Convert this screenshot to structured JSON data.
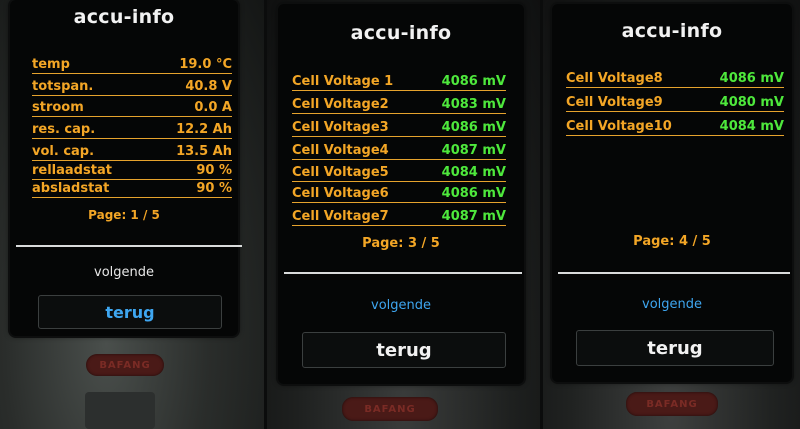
{
  "panels": [
    {
      "title": "accu-info",
      "rows": [
        {
          "label": "temp",
          "value": "19.0 °C",
          "value_color": "orange"
        },
        {
          "label": "totspan.",
          "value": "40.8 V",
          "value_color": "orange"
        },
        {
          "label": "stroom",
          "value": "0.0 A",
          "value_color": "orange"
        },
        {
          "label": "res. cap.",
          "value": "12.2 Ah",
          "value_color": "orange"
        },
        {
          "label": "vol. cap.",
          "value": "13.5 Ah",
          "value_color": "orange"
        },
        {
          "label": "rellaadstat",
          "value": "90 %",
          "value_color": "orange"
        },
        {
          "label": "absladstat",
          "value": "90 %",
          "value_color": "orange"
        }
      ],
      "page": "Page: 1 / 5",
      "next_label": "volgende",
      "back_label": "terug",
      "brand": "BAFANG"
    },
    {
      "title": "accu-info",
      "rows": [
        {
          "label": "Cell Voltage 1",
          "value": "4086 mV",
          "value_color": "green"
        },
        {
          "label": "Cell Voltage2",
          "value": "4083 mV",
          "value_color": "green"
        },
        {
          "label": "Cell Voltage3",
          "value": "4086 mV",
          "value_color": "green"
        },
        {
          "label": "Cell Voltage4",
          "value": "4087 mV",
          "value_color": "green"
        },
        {
          "label": "Cell Voltage5",
          "value": "4084 mV",
          "value_color": "green"
        },
        {
          "label": "Cell Voltage6",
          "value": "4086 mV",
          "value_color": "green"
        },
        {
          "label": "Cell Voltage7",
          "value": "4087 mV",
          "value_color": "green"
        }
      ],
      "page": "Page: 3 / 5",
      "next_label": "volgende",
      "back_label": "terug",
      "brand": "BAFANG"
    },
    {
      "title": "accu-info",
      "rows": [
        {
          "label": "Cell Voltage8",
          "value": "4086 mV",
          "value_color": "green"
        },
        {
          "label": "Cell Voltage9",
          "value": "4080 mV",
          "value_color": "green"
        },
        {
          "label": "Cell Voltage10",
          "value": "4084 mV",
          "value_color": "green"
        }
      ],
      "page": "Page: 4 / 5",
      "next_label": "volgende",
      "back_label": "terug",
      "brand": "BAFANG"
    }
  ],
  "colors": {
    "label": "#f3a626",
    "value_green": "#4ee83c",
    "title": "#f2f2f2",
    "next_button_p1": "#e8e8e8",
    "next_button_other": "#3ea6f0",
    "back_button_p1": "#3ea6f0",
    "back_button_other": "#f2f2f2"
  }
}
